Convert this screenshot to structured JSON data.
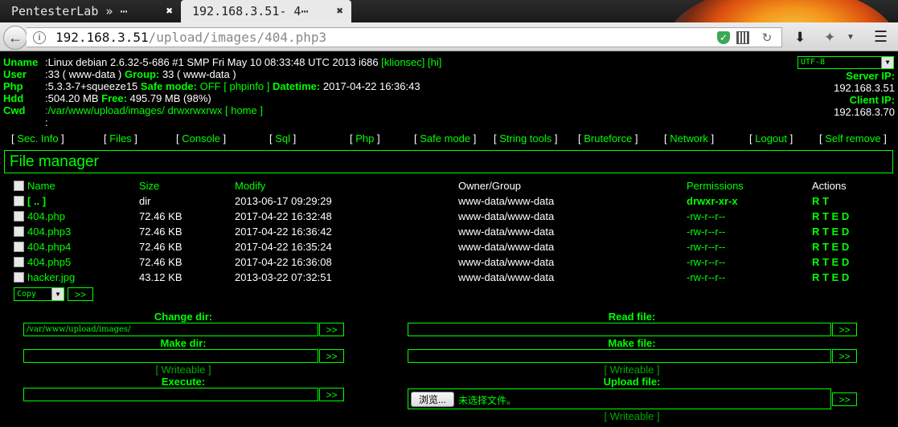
{
  "browser": {
    "tabs": [
      {
        "label": "PentesterLab » ⋯",
        "close": "✖"
      },
      {
        "label": "192.168.3.51- 4⋯",
        "close": "✖"
      }
    ],
    "url_host": "192.168.3.51",
    "url_path": "/upload/images/404.php3"
  },
  "sysinfo": {
    "uname_label": "Uname",
    "uname_value": ":Linux debian 2.6.32-5-686 #1 SMP Fri May 10 08:33:48 UTC 2013 i686",
    "uname_links": "[klionsec] [hi]",
    "user_label": "User",
    "user_value": ":33 ( www-data )",
    "group_label": "Group:",
    "group_value": "33 ( www-data )",
    "php_label": "Php",
    "php_value": ":5.3.3-7+squeeze15",
    "safemode_label": "Safe mode:",
    "safemode_value": "OFF",
    "phpinfo_link": "[ phpinfo ]",
    "datetime_label": "Datetime:",
    "datetime_value": "2017-04-22 16:36:43",
    "hdd_label": "Hdd",
    "hdd_value": ":504.20 MB",
    "free_label": "Free:",
    "free_value": "495.79 MB (98%)",
    "cwd_label": "Cwd",
    "cwd_value": ":/var/www/upload/images/",
    "cwd_perms": "drwxrwxrwx",
    "home_link": "[ home ]",
    "extra_line": ":",
    "charset": "UTF-8",
    "server_ip_label": "Server IP:",
    "server_ip": "192.168.3.51",
    "client_ip_label": "Client IP:",
    "client_ip": "192.168.3.70"
  },
  "menu": [
    "Sec. Info",
    "Files",
    "Console",
    "Sql",
    "Php",
    "Safe mode",
    "String tools",
    "Bruteforce",
    "Network",
    "Logout",
    "Self remove"
  ],
  "file_manager": {
    "title": "File manager",
    "columns": [
      "Name",
      "Size",
      "Modify",
      "Owner/Group",
      "Permissions",
      "Actions"
    ],
    "rows": [
      {
        "name": "[ .. ]",
        "size": "dir",
        "modify": "2013-06-17 09:29:29",
        "owner": "www-data/www-data",
        "perms": "drwxr-xr-x",
        "actions": "R T"
      },
      {
        "name": "404.php",
        "size": "72.46 KB",
        "modify": "2017-04-22 16:32:48",
        "owner": "www-data/www-data",
        "perms": "-rw-r--r--",
        "actions": "R T E D"
      },
      {
        "name": "404.php3",
        "size": "72.46 KB",
        "modify": "2017-04-22 16:36:42",
        "owner": "www-data/www-data",
        "perms": "-rw-r--r--",
        "actions": "R T E D"
      },
      {
        "name": "404.php4",
        "size": "72.46 KB",
        "modify": "2017-04-22 16:35:24",
        "owner": "www-data/www-data",
        "perms": "-rw-r--r--",
        "actions": "R T E D"
      },
      {
        "name": "404.php5",
        "size": "72.46 KB",
        "modify": "2017-04-22 16:36:08",
        "owner": "www-data/www-data",
        "perms": "-rw-r--r--",
        "actions": "R T E D"
      },
      {
        "name": "hacker.jpg",
        "size": "43.12 KB",
        "modify": "2013-03-22 07:32:51",
        "owner": "www-data/www-data",
        "perms": "-rw-r--r--",
        "actions": "R T E D"
      }
    ],
    "bulk_action": "Copy",
    "go": ">>"
  },
  "forms": {
    "change_dir_label": "Change dir:",
    "change_dir_value": "/var/www/upload/images/",
    "make_dir_label": "Make dir:",
    "writeable": "[ Writeable ]",
    "execute_label": "Execute:",
    "read_file_label": "Read file:",
    "make_file_label": "Make file:",
    "upload_file_label": "Upload file:",
    "browse_label": "浏览...",
    "no_file_label": "未选择文件。",
    "go": ">>"
  }
}
